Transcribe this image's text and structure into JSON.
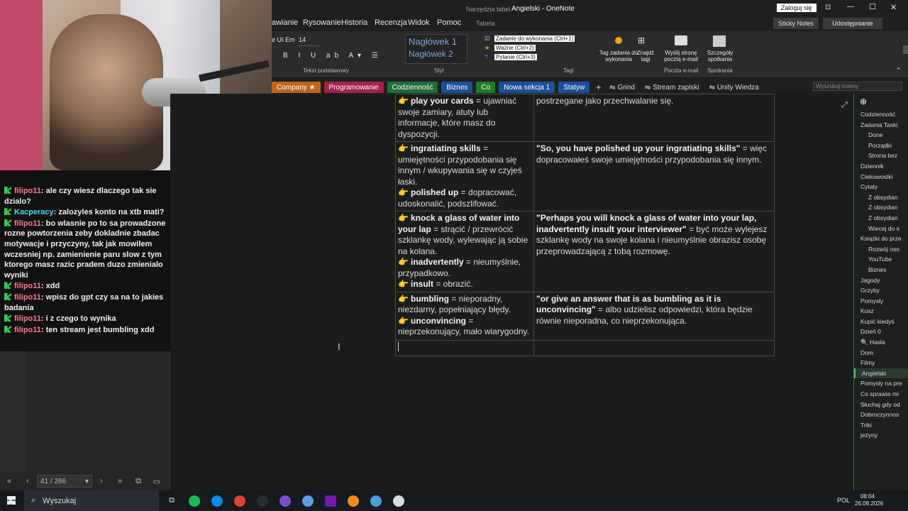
{
  "titlebar": {
    "tools_label": "Narzędzia tabel",
    "title": "Angielski - OneNote",
    "signin": "Zaloguj się",
    "minimize_glyph": "—",
    "maximize_glyph": "☐",
    "close_glyph": "✕"
  },
  "menu": {
    "tabs": [
      "awianie",
      "Rysowanie",
      "Historia",
      "Recenzja",
      "Widok",
      "Pomoc",
      "Tabela"
    ],
    "sticky_notes": "Sticky Notes",
    "sharing": "Udostępnianie"
  },
  "ribbon": {
    "font_name": "e UI Em",
    "font_size": "14",
    "group_basic_text": "Tekst podstawowy",
    "style_h1": "Nagłówek 1",
    "style_h2": "Nagłówek 2",
    "group_style": "Styl",
    "tags": [
      "Zadanie do wykonania (Ctrl+1)",
      "Ważne (Ctrl+2)",
      "Pytanie (Ctrl+3)"
    ],
    "tag_task_label": "Tag zadania do wykonania",
    "find_tags_label": "Znajdź tagi",
    "group_tags": "Tagi",
    "email_label": "Wyślij stronę pocztą e-mail",
    "group_email": "Poczta e-mail",
    "meeting_label": "Szczegóły spotkania",
    "group_meetings": "Spotkania"
  },
  "sections": [
    {
      "label": "Company ★",
      "color": "#c0631d"
    },
    {
      "label": "Programowanie",
      "color": "#a0234a"
    },
    {
      "label": "Codzienność",
      "color": "#1e6e3a"
    },
    {
      "label": "Biznes",
      "color": "#1d4e9a"
    },
    {
      "label": "Co",
      "color": "#1e7d2a"
    },
    {
      "label": "Nowa sekcja 1",
      "color": "#1d4e9a"
    },
    {
      "label": "Statyw",
      "color": "#1d4e9a"
    }
  ],
  "section_add": "+",
  "section_links": [
    "Grind",
    "Stream zapiski",
    "Unity Wiedza"
  ],
  "search": {
    "placeholder": "Wyszukaj notesy"
  },
  "chat": [
    {
      "user": "filipo11",
      "text": "ale czy wiesz dlaczego tak sie dzialo?",
      "alt": false
    },
    {
      "user": "Kacperacy",
      "text": "zalozyles konto na xtb mati?",
      "alt": true
    },
    {
      "user": "filipo11",
      "text": "bo wlasnie po to sa prowadzone rozne powtorzenia zeby dokladnie zbadac motywacje i przyczyny, tak jak mowilem wczesniej np. zamienienie paru slow z tym ktorego masz razic pradem duzo zmienialo wyniki",
      "alt": false
    },
    {
      "user": "filipo11",
      "text": "xdd",
      "alt": false
    },
    {
      "user": "filipo11",
      "text": "wpisz do gpt czy sa na to jakies badania",
      "alt": false
    },
    {
      "user": "filipo11",
      "text": "i z czego to wynika",
      "alt": false
    },
    {
      "user": "filipo11",
      "text": "ten stream jest bumbling xdd",
      "alt": false
    }
  ],
  "pager": {
    "count": "41 / 266"
  },
  "notes": {
    "row0_left_term": "play your cards",
    "row0_left_def": " = ujawniać swoje zamiary, atuty lub informacje, które masz do dyspozycji.",
    "row0_right": "postrzegane jako przechwalanie się.",
    "row1_left_term1": "ingratiating skills",
    "row1_left_def1": " = umiejętności przypodobania się innym / wkupywania się w czyjeś łaski.",
    "row1_left_term2": "polished up",
    "row1_left_def2": " = dopracować, udoskonalić, podszlifować.",
    "row1_right_quote": "\"So, you have polished up your ingratiating skills\"",
    "row1_right_tr": " = więc dopracowałeś swoje umiejętności przypodobania się innym.",
    "row2_left_term1": "knock a glass of water into your lap",
    "row2_left_def1": " = strącić / przewrócić szklankę wody, wylewając ją sobie na kolana.",
    "row2_left_term2": "inadvertently",
    "row2_left_def2": " = nieumyślnie, przypadkowo.",
    "row2_left_term3": "insult",
    "row2_left_def3": " = obrazić.",
    "row2_right_quote": "\"Perhaps you will knock a glass of water into your lap, inadvertently insult your interviewer\"",
    "row2_right_tr": " = być może wylejesz szklankę wody na swoje kolana i nieumyślnie obrazisz osobę przeprowadzającą z tobą rozmowę.",
    "row3_left_term1": "bumbling",
    "row3_left_def1": " = nieporadny, niezdarny, popełniający błędy.",
    "row3_left_term2": "unconvincing",
    "row3_left_def2": " = nieprzekonujący, mało wiarygodny.",
    "row3_right_quote": "\"or give an answer that is as bumbling as it is unconvincing\"",
    "row3_right_tr": " = albo udzielisz odpowiedzi, która będzie równie nieporadna, co nieprzekonująca."
  },
  "pages": [
    {
      "label": "Codzienność",
      "sub": false,
      "active": false
    },
    {
      "label": "Zadania Taski",
      "sub": false,
      "active": false
    },
    {
      "label": "Done",
      "sub": true,
      "active": false
    },
    {
      "label": "Porządki",
      "sub": true,
      "active": false
    },
    {
      "label": "Strona bez",
      "sub": true,
      "active": false
    },
    {
      "label": "Dziennik",
      "sub": false,
      "active": false
    },
    {
      "label": "Ciekowostki",
      "sub": false,
      "active": false
    },
    {
      "label": "Cytaty",
      "sub": false,
      "active": false
    },
    {
      "label": "Z obsydian",
      "sub": true,
      "active": false
    },
    {
      "label": "Z obsydian",
      "sub": true,
      "active": false
    },
    {
      "label": "Z obsydian",
      "sub": true,
      "active": false
    },
    {
      "label": "Wiecej do s",
      "sub": true,
      "active": false
    },
    {
      "label": "Książki do prze",
      "sub": false,
      "active": false
    },
    {
      "label": "Rozwój oso",
      "sub": true,
      "active": false
    },
    {
      "label": "YouTube",
      "sub": true,
      "active": false
    },
    {
      "label": "Biznes",
      "sub": true,
      "active": false
    },
    {
      "label": "Jagody",
      "sub": false,
      "active": false
    },
    {
      "label": "Grzyby",
      "sub": false,
      "active": false
    },
    {
      "label": "Pomysły",
      "sub": false,
      "active": false
    },
    {
      "label": "Kosz",
      "sub": false,
      "active": false
    },
    {
      "label": "Kupić kiedyś",
      "sub": false,
      "active": false
    },
    {
      "label": "Dzień 0",
      "sub": false,
      "active": false
    },
    {
      "label": "🔍 Hasła",
      "sub": false,
      "active": false
    },
    {
      "label": "Dom",
      "sub": false,
      "active": false
    },
    {
      "label": "Filmy",
      "sub": false,
      "active": false
    },
    {
      "label": "Angielski",
      "sub": false,
      "active": true
    },
    {
      "label": "Pomysły na pre",
      "sub": false,
      "active": false
    },
    {
      "label": "Co sprawia mi",
      "sub": false,
      "active": false
    },
    {
      "label": "Słuchaj gdy od",
      "sub": false,
      "active": false
    },
    {
      "label": "Dobroczynnos",
      "sub": false,
      "active": false
    },
    {
      "label": "Triki",
      "sub": false,
      "active": false
    },
    {
      "label": "jeżyny",
      "sub": false,
      "active": false
    }
  ],
  "taskbar": {
    "search_label": "Wyszukaj",
    "lang": "POL",
    "time": "08:04",
    "date": "26.08.2026",
    "app_colors": [
      "#1db954",
      "#0c8ae5",
      "#e34133",
      "#2d2d2d",
      "#7b4cc9",
      "#5aa0e0",
      "#7719aa",
      "#f08a1d",
      "#4aa0d8",
      "#dddddd"
    ]
  }
}
